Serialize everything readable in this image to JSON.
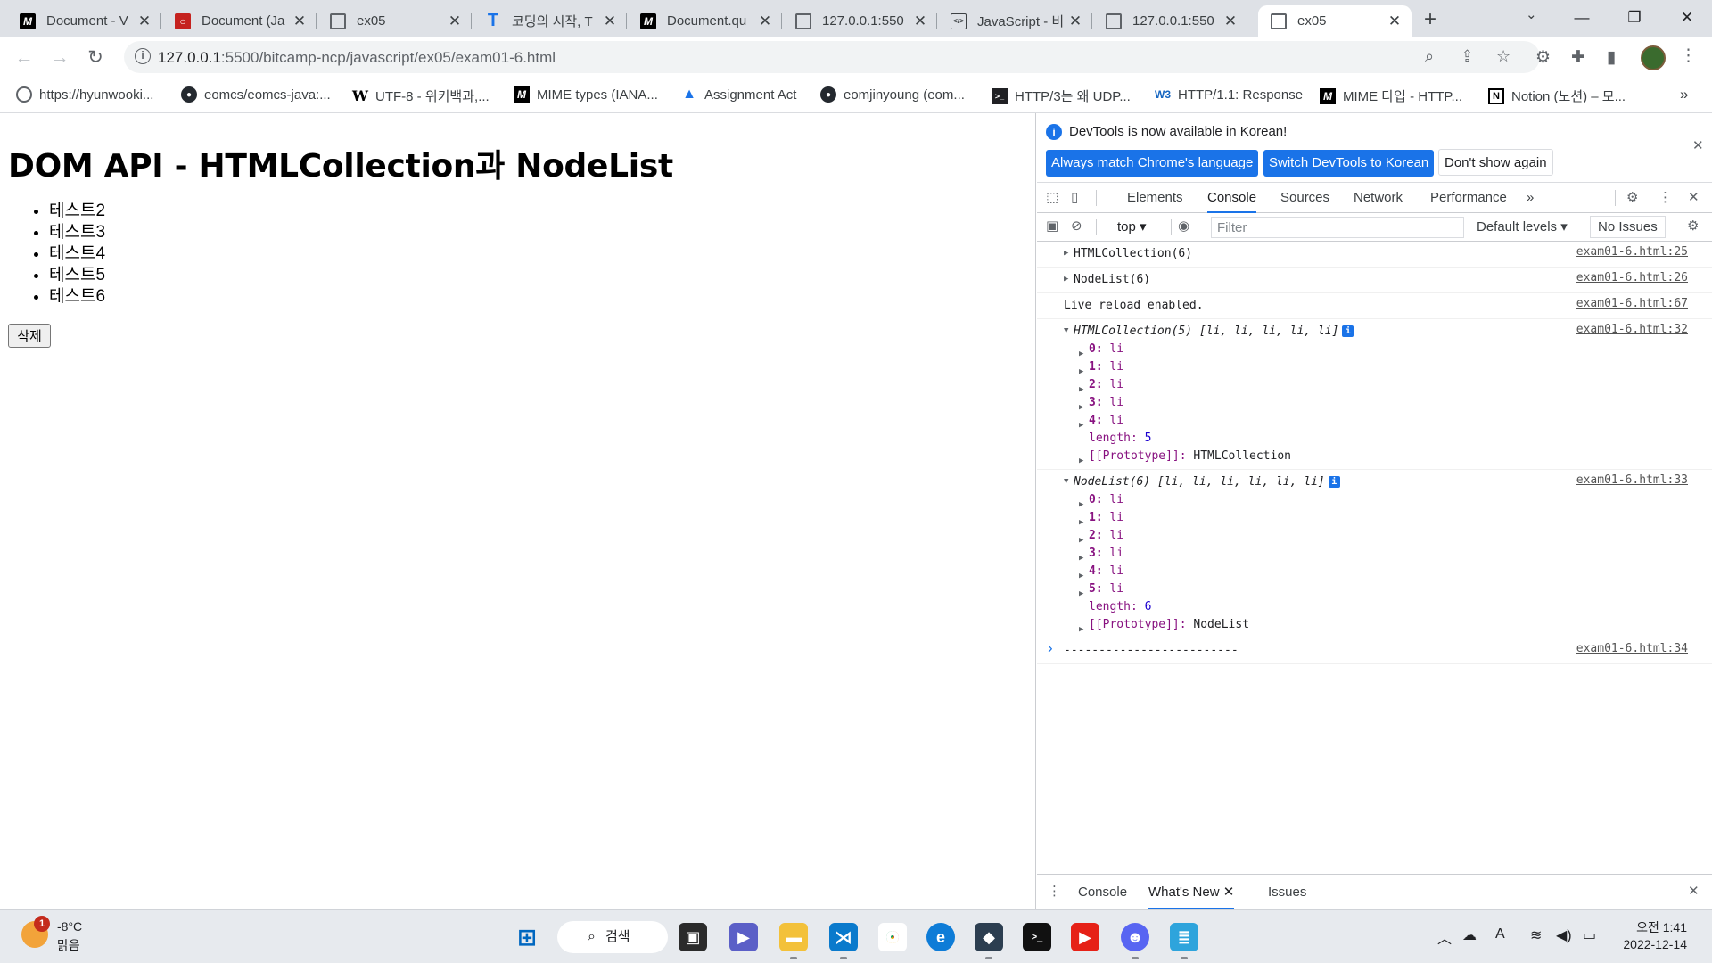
{
  "browser": {
    "tabs": [
      {
        "title": "Document - V",
        "icon": "mdn-icon"
      },
      {
        "title": "Document (Ja",
        "icon": "oracle-icon"
      },
      {
        "title": "ex05",
        "icon": "globe-icon"
      },
      {
        "title": "코딩의 시작, T",
        "icon": "tcp-school-icon"
      },
      {
        "title": "Document.qu",
        "icon": "mdn-icon"
      },
      {
        "title": "127.0.0.1:550",
        "icon": "globe-icon"
      },
      {
        "title": "JavaScript - 비",
        "icon": "code-icon"
      },
      {
        "title": "127.0.0.1:550",
        "icon": "globe-icon"
      },
      {
        "title": "ex05",
        "icon": "globe-icon",
        "active": true
      }
    ],
    "url_host": "127.0.0.1",
    "url_path": ":5500/bitcamp-ncp/javascript/ex05/exam01-6.html",
    "bookmarks": [
      {
        "label": "https://hyunwooki...",
        "icon": "globe-icon"
      },
      {
        "label": "eomcs/eomcs-java:...",
        "icon": "github-icon"
      },
      {
        "label": "UTF-8 - 위키백과,...",
        "icon": "wikipedia-icon"
      },
      {
        "label": "MIME types (IANA...",
        "icon": "mdn-icon"
      },
      {
        "label": "Assignment Act",
        "icon": "triangle-icon"
      },
      {
        "label": "eomjinyoung (eom...",
        "icon": "github-icon"
      },
      {
        "label": "HTTP/3는 왜 UDP...",
        "icon": "terminal-icon"
      },
      {
        "label": "HTTP/1.1: Response",
        "icon": "w3c-icon"
      },
      {
        "label": "MIME 타입 - HTTP...",
        "icon": "mdn-icon"
      },
      {
        "label": "Notion (노션) – 모...",
        "icon": "notion-icon"
      }
    ]
  },
  "page": {
    "title": "DOM API - HTMLCollection과 NodeList",
    "items": [
      "테스트2",
      "테스트3",
      "테스트4",
      "테스트5",
      "테스트6"
    ],
    "delete_label": "삭제"
  },
  "devtools": {
    "banner_text": "DevTools is now available in Korean!",
    "banner_btn_match": "Always match Chrome's language",
    "banner_btn_switch": "Switch DevTools to Korean",
    "banner_btn_dismiss": "Don't show again",
    "tabs": [
      "Elements",
      "Console",
      "Sources",
      "Network",
      "Performance"
    ],
    "more_tabs": "»",
    "context": "top",
    "filter_placeholder": "Filter",
    "levels": "Default levels",
    "issues": "No Issues",
    "drawer_tabs": [
      "Console",
      "What's New",
      "Issues"
    ],
    "console": {
      "r1_msg": "HTMLCollection(6)",
      "r1_src": "exam01-6.html:25",
      "r2_msg": "NodeList(6)",
      "r2_src": "exam01-6.html:26",
      "r3_msg": "Live reload enabled.",
      "r3_src": "exam01-6.html:67",
      "r4_head": "HTMLCollection(5) [li, li, li, li, li]",
      "r4_src": "exam01-6.html:32",
      "r4_children": [
        "0",
        "1",
        "2",
        "3",
        "4"
      ],
      "r4_length_label": "length",
      "r4_length": "5",
      "r4_proto": "HTMLCollection",
      "r5_head": "NodeList(6) [li, li, li, li, li, li]",
      "r5_src": "exam01-6.html:33",
      "r5_children": [
        "0",
        "1",
        "2",
        "3",
        "4",
        "5"
      ],
      "r5_length_label": "length",
      "r5_length": "6",
      "r5_proto": "NodeList",
      "r6_msg": "-------------------------",
      "r6_src": "exam01-6.html:34",
      "child_value": "li",
      "proto_label": "[[Prototype]]"
    }
  },
  "taskbar": {
    "weather_temp": "-8°C",
    "weather_cond": "맑음",
    "weather_badge": "1",
    "search_label": "검색",
    "time": "오전 1:41",
    "date": "2022-12-14"
  }
}
